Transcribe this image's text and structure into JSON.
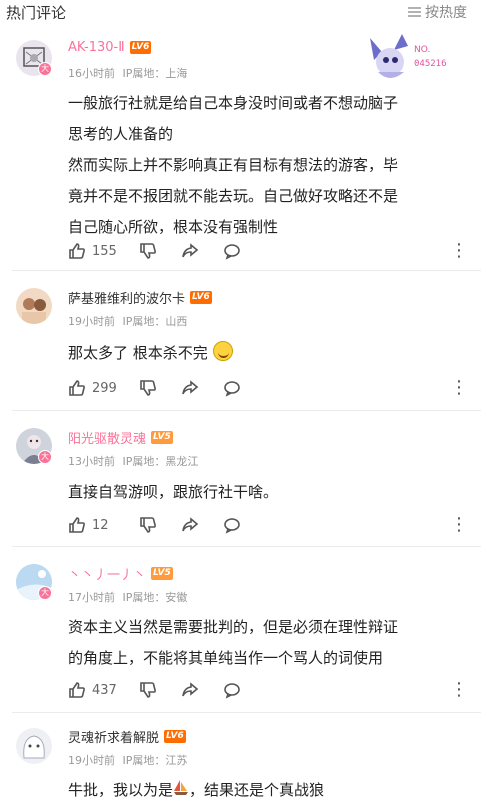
{
  "header": {
    "title": "热门评论",
    "sort_label": "按热度"
  },
  "comments": [
    {
      "username": "AK-130-Ⅱ",
      "level": "LV6",
      "time": "16小时前",
      "location": "IP属地：上海",
      "lines": [
        "一般旅行社就是给自己本身没时间或者不想动脑子",
        "思考的人准备的",
        "然而实际上并不影响真正有目标有想法的游客，毕",
        "竟并不是不报团就不能去玩。自己做好攻略还不是",
        "自己随心所欲，根本没有强制性"
      ],
      "likes": "155",
      "badge": "大",
      "medal_text": "NO.",
      "medal_number": "045216"
    },
    {
      "username": "萨基雅维利的波尔卡",
      "level": "LV6",
      "time": "19小时前",
      "location": "IP属地：山西",
      "lines": [
        "那太多了 根本杀不完"
      ],
      "likes": "299"
    },
    {
      "username": "阳光驱散灵魂",
      "level": "LV5",
      "time": "13小时前",
      "location": "IP属地：黑龙江",
      "lines": [
        "直接自驾游呗，跟旅行社干啥。"
      ],
      "likes": "12",
      "badge": "大"
    },
    {
      "username": "丶丶丿一丿丶",
      "level": "LV5",
      "time": "17小时前",
      "location": "IP属地：安徽",
      "lines": [
        "资本主义当然是需要批判的，但是必须在理性辩证",
        "的角度上，不能将其单纯当作一个骂人的词使用"
      ],
      "likes": "437",
      "badge": "大"
    },
    {
      "username": "灵魂祈求着解脱",
      "level": "LV6",
      "time": "19小时前",
      "location": "IP属地：江苏",
      "line_before": "牛批，我以为是",
      "line_after": "，结果还是个真战狼"
    }
  ],
  "colors": {
    "accent": "#fb7299",
    "lv6": "#ff6c00",
    "lv5": "#ff9a3d"
  }
}
